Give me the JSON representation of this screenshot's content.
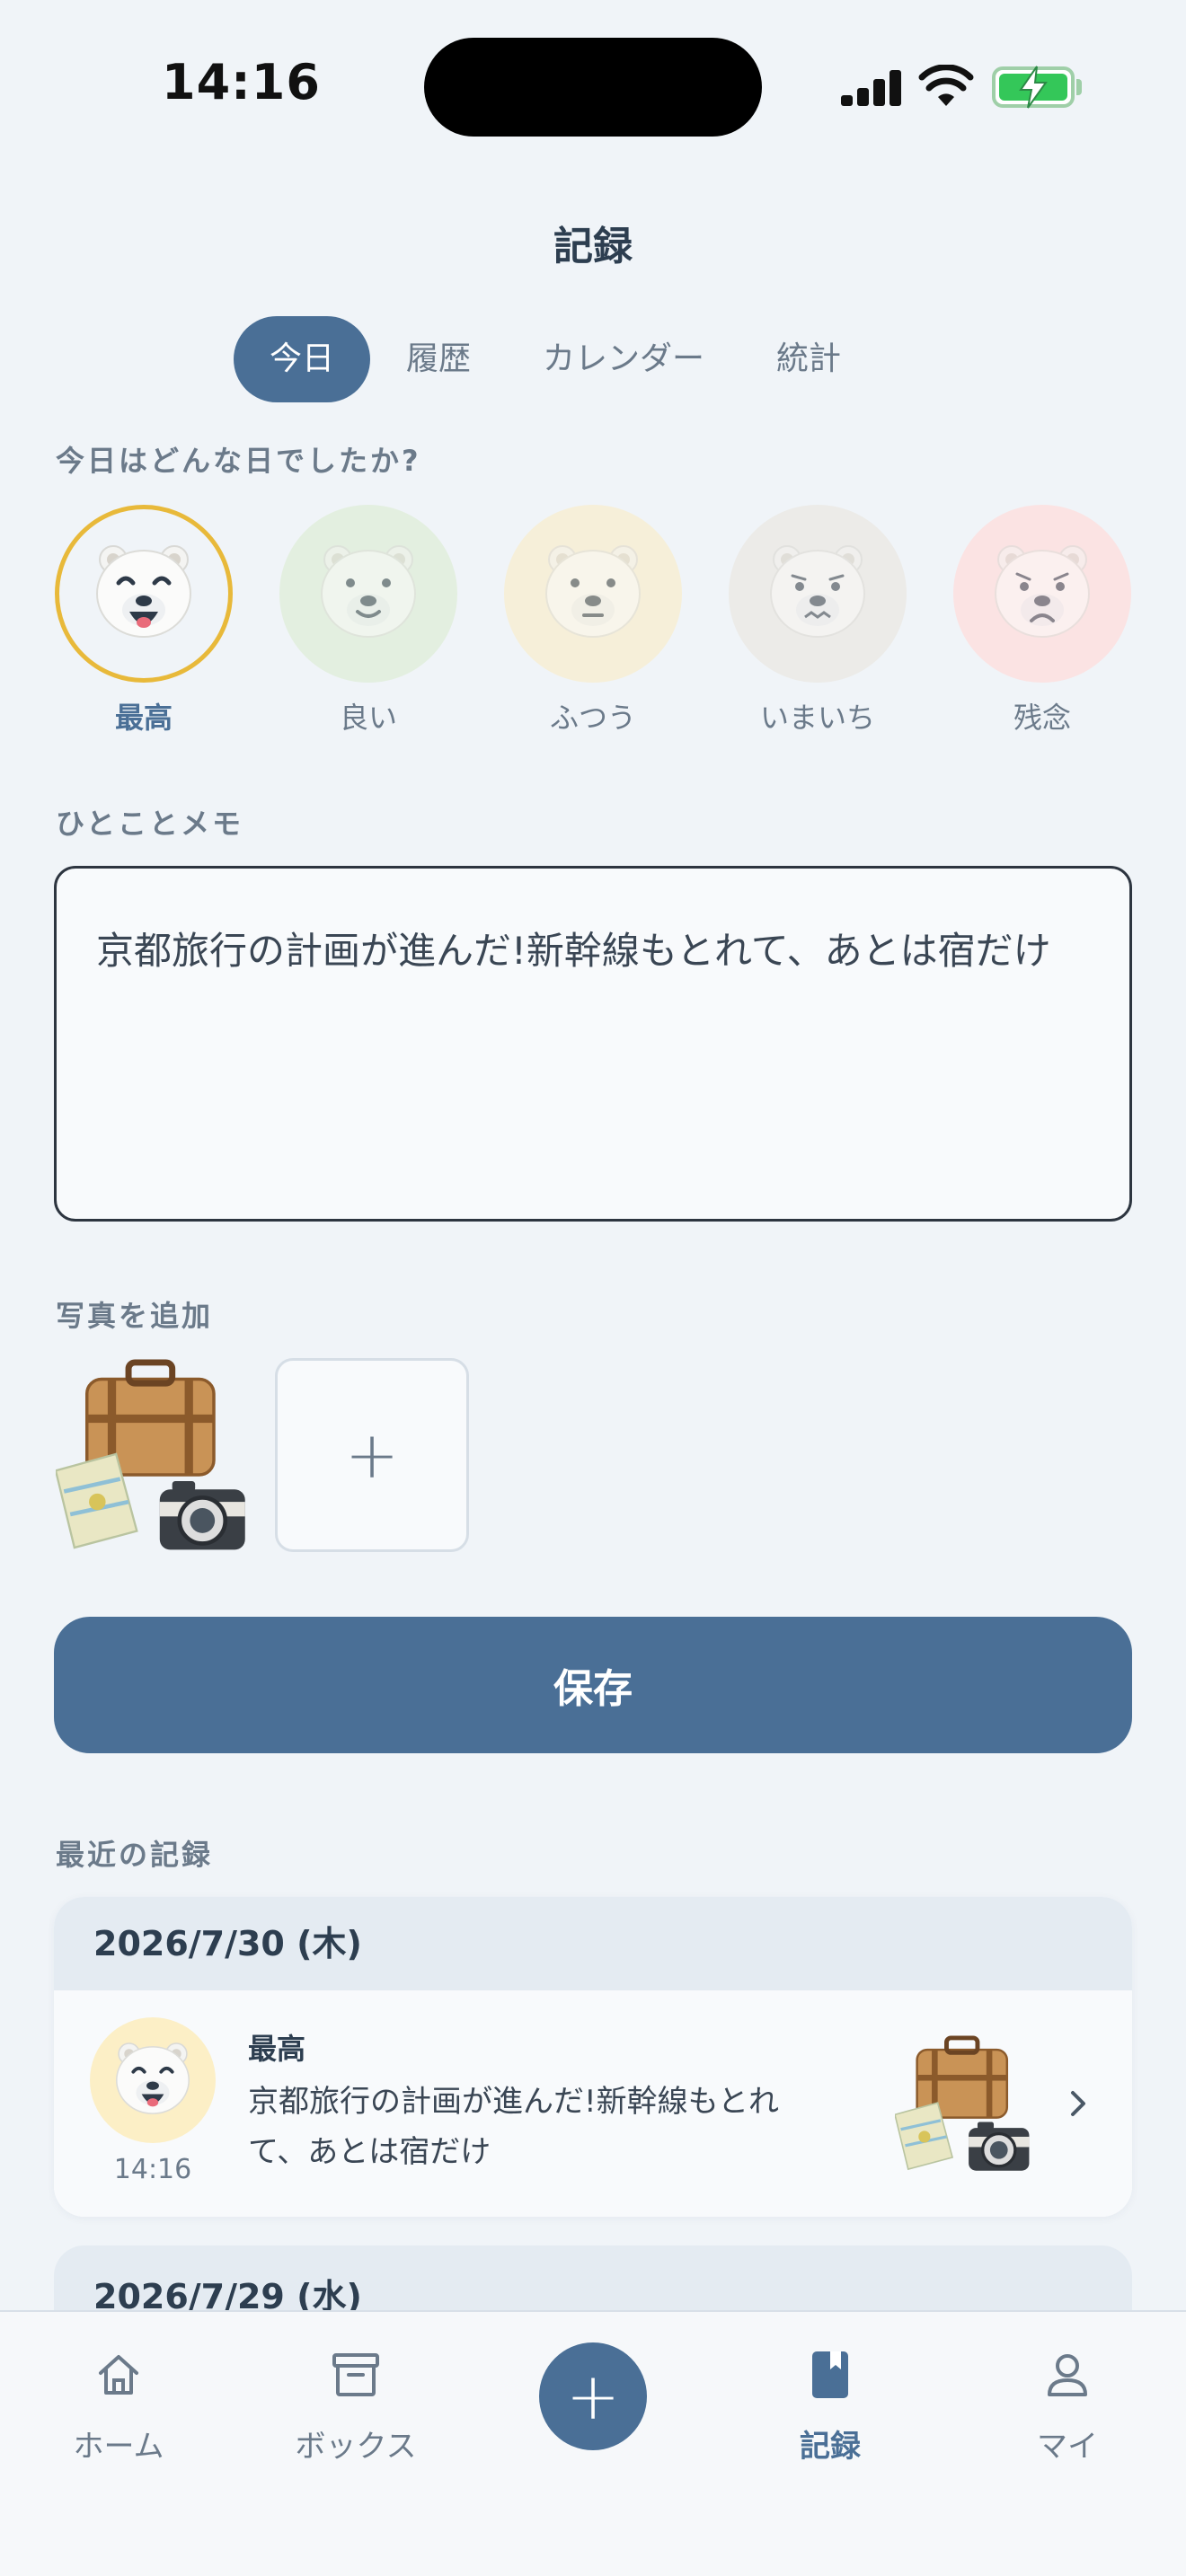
{
  "status_bar": {
    "time": "14:16"
  },
  "header": {
    "title": "記録"
  },
  "tabs": [
    {
      "label": "今日",
      "active": true
    },
    {
      "label": "履歴",
      "active": false
    },
    {
      "label": "カレンダー",
      "active": false
    },
    {
      "label": "統計",
      "active": false
    }
  ],
  "mood_section": {
    "question": "今日はどんな日でしたか?",
    "options": [
      {
        "label": "最高",
        "selected": true,
        "bg": "#fcefc6"
      },
      {
        "label": "良い",
        "selected": false,
        "bg": "#e3efe0"
      },
      {
        "label": "ふつう",
        "selected": false,
        "bg": "#f6efd9"
      },
      {
        "label": "いまいち",
        "selected": false,
        "bg": "#ecebe8"
      },
      {
        "label": "残念",
        "selected": false,
        "bg": "#fbe3e3"
      }
    ]
  },
  "memo_section": {
    "label": "ひとことメモ",
    "value": "京都旅行の計画が進んだ!新幹線もとれて、あとは宿だけ"
  },
  "photo_section": {
    "label": "写真を追加",
    "add_symbol": "+"
  },
  "save_button": {
    "label": "保存"
  },
  "recent": {
    "label": "最近の記録",
    "entries": [
      {
        "date": "2026/7/30 (木)",
        "mood": "最高",
        "time": "14:16",
        "text": "京都旅行の計画が進んだ!新幹線もとれて、あとは宿だけ",
        "text_line1": "京都旅行の計画が進んだ!新幹線もとれ",
        "text_line2": "て、あとは宿だけ"
      },
      {
        "date": "2026/7/29 (水)"
      }
    ]
  },
  "bottom_nav": {
    "items": [
      {
        "label": "ホーム",
        "icon": "home-icon",
        "active": false
      },
      {
        "label": "ボックス",
        "icon": "archive-box-icon",
        "active": false
      },
      {
        "label": "記録",
        "icon": "bookmark-icon",
        "active": true
      },
      {
        "label": "マイ",
        "icon": "person-icon",
        "active": false
      }
    ],
    "fab_symbol": "+"
  },
  "colors": {
    "accent": "#4a6f96",
    "background": "#f0f4f8",
    "selected_ring": "#e8b93a"
  }
}
